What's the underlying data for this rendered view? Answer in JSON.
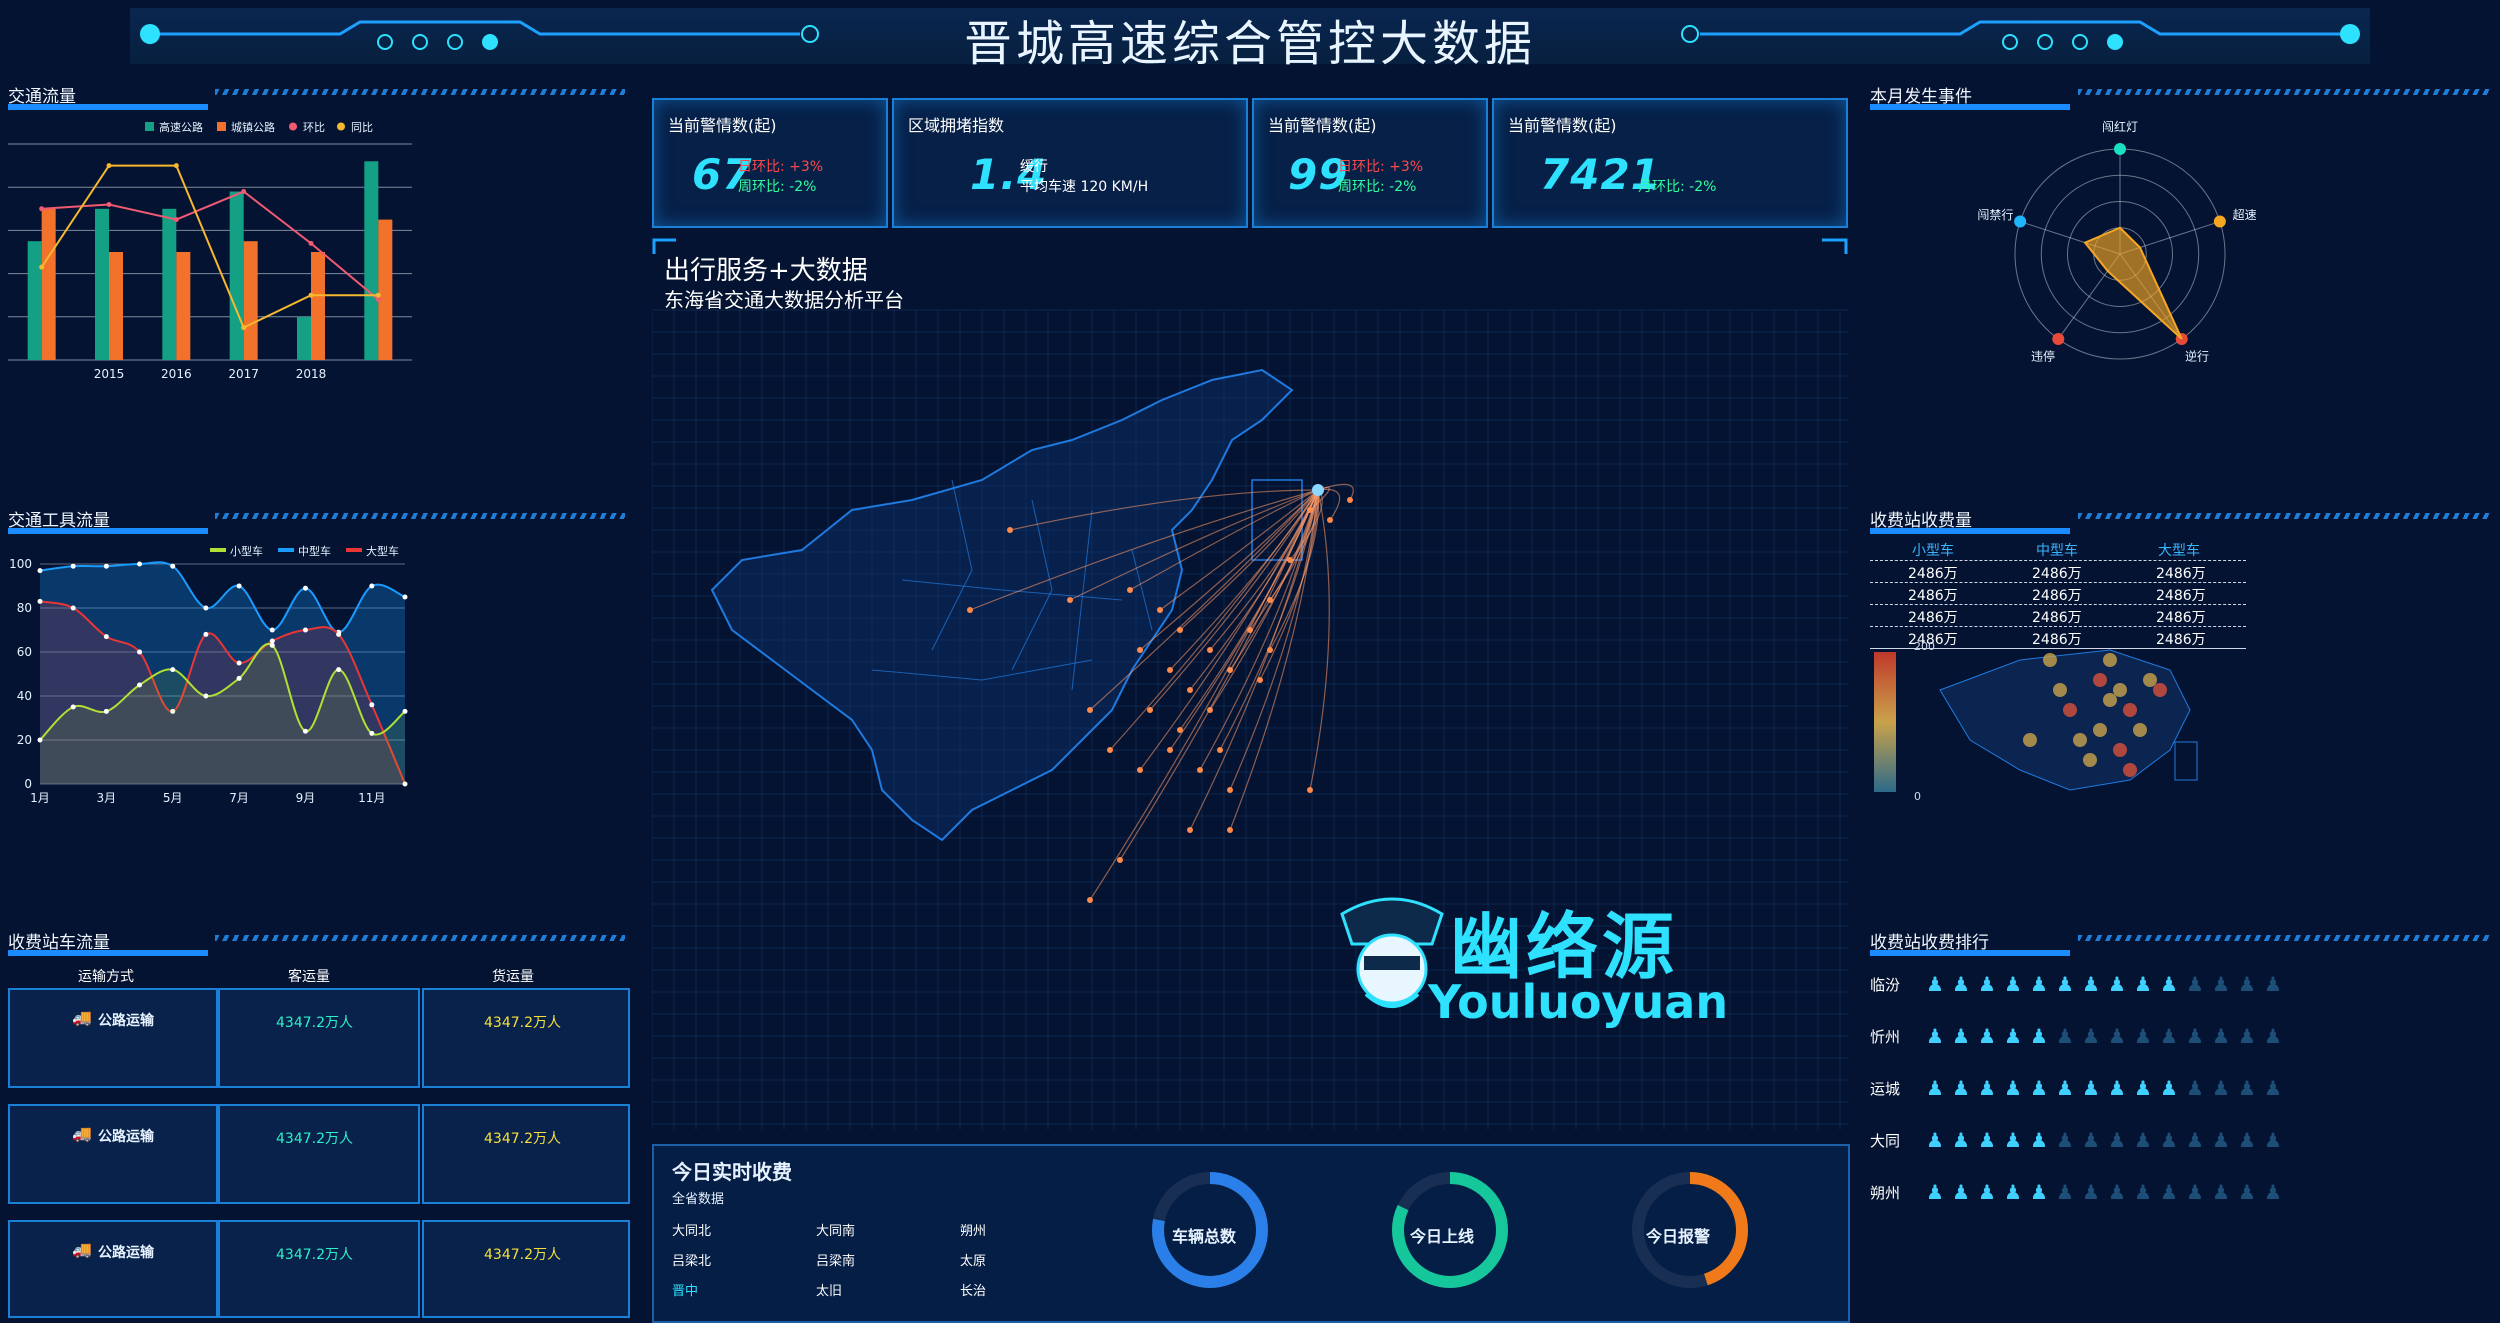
{
  "header": {
    "title": "晋城高速综合管控大数据"
  },
  "traffic_flow": {
    "title": "交通流量",
    "legend": [
      {
        "name": "高速公路",
        "color": "#14a085"
      },
      {
        "name": "城镇公路",
        "color": "#f2722b"
      },
      {
        "name": "环比",
        "color": "#f05a73"
      },
      {
        "name": "同比",
        "color": "#f5b82e"
      }
    ],
    "chart_data": {
      "type": "bar",
      "categories": [
        "",
        "2015",
        "2016",
        "2017",
        "2018",
        ""
      ],
      "series": [
        {
          "name": "高速公路",
          "type": "bar",
          "values": [
            5.5,
            7,
            7,
            7.8,
            2,
            9.2
          ]
        },
        {
          "name": "城镇公路",
          "type": "bar",
          "values": [
            7,
            5,
            5,
            5.5,
            5,
            6.5
          ]
        },
        {
          "name": "环比",
          "type": "line",
          "values": [
            7,
            7.2,
            6.5,
            7.8,
            5.4,
            2.8
          ]
        },
        {
          "name": "同比",
          "type": "line",
          "values": [
            4.3,
            9,
            9,
            1.5,
            3,
            3
          ]
        }
      ],
      "ylim": [
        0,
        10
      ]
    }
  },
  "vehicle_flow": {
    "title": "交通工具流量",
    "legend": [
      {
        "name": "小型车",
        "color": "#b0e033"
      },
      {
        "name": "中型车",
        "color": "#1a9cff"
      },
      {
        "name": "大型车",
        "color": "#e83636"
      }
    ],
    "chart_data": {
      "type": "area",
      "x": [
        "1月",
        "2月",
        "3月",
        "4月",
        "5月",
        "6月",
        "7月",
        "8月",
        "9月",
        "10月",
        "11月",
        "12月"
      ],
      "xticks": [
        "1月",
        "3月",
        "5月",
        "7月",
        "9月",
        "11月"
      ],
      "series": [
        {
          "name": "小型车",
          "values": [
            20,
            35,
            33,
            45,
            52,
            40,
            48,
            63,
            24,
            52,
            23,
            33
          ]
        },
        {
          "name": "中型车",
          "values": [
            97,
            99,
            99,
            100,
            99,
            80,
            90,
            70,
            89,
            69,
            90,
            85
          ]
        },
        {
          "name": "大型车",
          "values": [
            83,
            80,
            67,
            60,
            33,
            68,
            55,
            65,
            70,
            68,
            36,
            0
          ]
        }
      ],
      "yticks": [
        "0",
        "20",
        "40",
        "60",
        "80",
        "100"
      ],
      "ylim": [
        0,
        100
      ]
    }
  },
  "toll_station_flow": {
    "title": "收费站车流量",
    "headers": [
      "运输方式",
      "客运量",
      "货运量"
    ],
    "rows": [
      {
        "type": "公路运输",
        "passenger": "4347.2万人",
        "cargo": "4347.2万人"
      },
      {
        "type": "公路运输",
        "passenger": "4347.2万人",
        "cargo": "4347.2万人"
      },
      {
        "type": "公路运输",
        "passenger": "4347.2万人",
        "cargo": "4347.2万人"
      }
    ]
  },
  "kpis": [
    {
      "title": "当前警情数(起)",
      "value": "67",
      "line1": "日环比: +3%",
      "line2": "周环比: -2%"
    },
    {
      "title": "区域拥堵指数",
      "value": "1.4",
      "line1": "缓行",
      "line2": "平均车速 120 KM/H"
    },
    {
      "title": "当前警情数(起)",
      "value": "99",
      "line1": "日环比: +3%",
      "line2": "周环比: -2%"
    },
    {
      "title": "当前警情数(起)",
      "value": "7421",
      "line1": "月环比: -2%",
      "line2": ""
    }
  ],
  "center": {
    "title": "出行服务+大数据",
    "subtitle": "东海省交通大数据分析平台"
  },
  "watermark": {
    "name": "幽络源",
    "latin": "Youluoyuan"
  },
  "today_toll": {
    "title": "今日实时收费",
    "sub": "全省数据",
    "cities": [
      [
        "大同北",
        "大同南",
        "朔州"
      ],
      [
        "吕梁北",
        "吕梁南",
        "太原"
      ],
      [
        "晋中",
        "太旧",
        "长治"
      ]
    ],
    "active_city": "晋中",
    "rings": [
      {
        "label": "车辆总数",
        "fraction": 0.78,
        "color": "#2b7fe8"
      },
      {
        "label": "今日上线",
        "fraction": 0.82,
        "color": "#15c79a"
      },
      {
        "label": "今日报警",
        "fraction": 0.45,
        "color": "#f07a1a"
      }
    ]
  },
  "monthly_events": {
    "title": "本月发生事件",
    "chart_data": {
      "type": "radar",
      "axes": [
        {
          "name": "闯红灯",
          "color": "#18e0c0",
          "value": 0.25
        },
        {
          "name": "超速",
          "color": "#f5a623",
          "value": 0.2
        },
        {
          "name": "逆行",
          "color": "#e84a3a",
          "value": 1.0
        },
        {
          "name": "违停",
          "color": "#e84a3a",
          "value": 0.2
        },
        {
          "name": "闯禁行",
          "color": "#1fb6ff",
          "value": 0.35
        }
      ]
    }
  },
  "toll_fees": {
    "title": "收费站收费量",
    "headers": [
      "小型车",
      "中型车",
      "大型车"
    ],
    "rows": [
      [
        "2486万",
        "2486万",
        "2486万"
      ],
      [
        "2486万",
        "2486万",
        "2486万"
      ],
      [
        "2486万",
        "2486万",
        "2486万"
      ],
      [
        "2486万",
        "2486万",
        "2486万"
      ]
    ],
    "scale_max": "200",
    "scale_min": "0"
  },
  "toll_ranking": {
    "title": "收费站收费排行",
    "rows": [
      {
        "name": "临汾",
        "filled": 10,
        "total": 14
      },
      {
        "name": "忻州",
        "filled": 5,
        "total": 14
      },
      {
        "name": "运城",
        "filled": 10,
        "total": 14
      },
      {
        "name": "大同",
        "filled": 5,
        "total": 14
      },
      {
        "name": "朔州",
        "filled": 5,
        "total": 14
      }
    ]
  }
}
